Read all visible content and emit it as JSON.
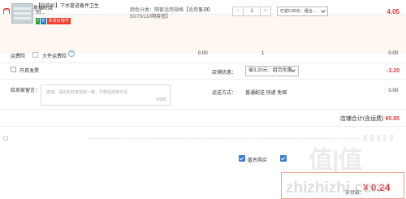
{
  "shop": {
    "name": "店铺：七星猫旺店"
  },
  "product": {
    "title": "【狂欢价】下水管道备件卫生间…",
    "tags": [
      "7",
      "天",
      "年货好物节"
    ],
    "spec": "颜色分类：隔套适用规格【适用于50/75/110隔套管】",
    "unit_price": "5.00",
    "quantity": "1",
    "coupon_select": "已省0.95元：组合…",
    "line_total": "4.05"
  },
  "freight_insurance": {
    "label": "运费险",
    "option": "大件运费险",
    "help": "?",
    "price": "0.00",
    "qty": "1",
    "total": "0.00"
  },
  "gift": {
    "label": "开具发票"
  },
  "promo": {
    "label": "店铺优惠：",
    "select": "省3.20元：组合优惠",
    "total": "-3.20"
  },
  "message": {
    "label": "给卖家留言：",
    "placeholder": "选填，请先和商家协商一致，付款后商家可见",
    "counter": "0/200"
  },
  "shipping": {
    "label": "运送方式：",
    "text": "普通配送 快递 免邮",
    "total": "0.00"
  },
  "subtotal": {
    "label": "店铺合计(含运费)",
    "amount": "¥0.85"
  },
  "bottom": {
    "anonymous": "匿名购买",
    "payable_label": "实付款：",
    "payable_amount": "¥ 0.24"
  },
  "watermark": {
    "logo": "值|值",
    "url": "zhizhizhi.com"
  },
  "colors": {
    "accent": "#e4393c",
    "checkbox": "#3a7bd5",
    "row_bg": "#fff7f2"
  }
}
